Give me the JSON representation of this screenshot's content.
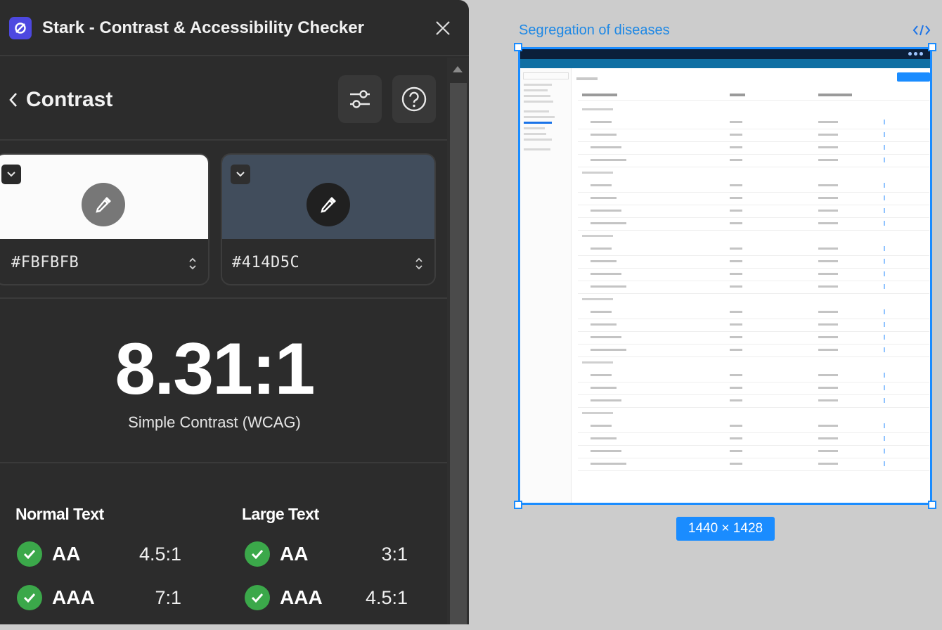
{
  "plugin": {
    "title": "Stark - Contrast & Accessibility Checker",
    "section": "Contrast",
    "swatches": [
      {
        "hex": "#FBFBFB",
        "color": "#FBFBFB"
      },
      {
        "hex": "#414D5C",
        "color": "#414D5C"
      }
    ],
    "ratio": "8.31:1",
    "ratio_label": "Simple Contrast (WCAG)",
    "normal_text": {
      "heading": "Normal Text",
      "levels": [
        {
          "level": "AA",
          "requirement": "4.5:1"
        },
        {
          "level": "AAA",
          "requirement": "7:1"
        }
      ]
    },
    "large_text": {
      "heading": "Large Text",
      "levels": [
        {
          "level": "AA",
          "requirement": "3:1"
        },
        {
          "level": "AAA",
          "requirement": "4.5:1"
        }
      ]
    },
    "colors": {
      "panel": "#2C2C2C",
      "pass": "#3BA84A",
      "logo": "#4D48E0"
    }
  },
  "canvas": {
    "frame_name": "Segregation of diseases",
    "frame_size": "1440 × 1428",
    "selection_color": "#1A8CFF"
  }
}
